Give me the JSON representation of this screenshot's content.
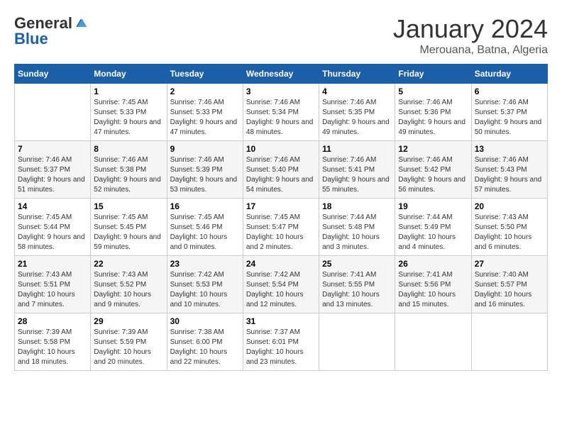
{
  "logo": {
    "general": "General",
    "blue": "Blue"
  },
  "title": {
    "month_year": "January 2024",
    "location": "Merouana, Batna, Algeria"
  },
  "weekdays": [
    "Sunday",
    "Monday",
    "Tuesday",
    "Wednesday",
    "Thursday",
    "Friday",
    "Saturday"
  ],
  "weeks": [
    [
      {
        "day": null,
        "sunrise": null,
        "sunset": null,
        "daylight": null
      },
      {
        "day": "1",
        "sunrise": "Sunrise: 7:45 AM",
        "sunset": "Sunset: 5:33 PM",
        "daylight": "Daylight: 9 hours and 47 minutes."
      },
      {
        "day": "2",
        "sunrise": "Sunrise: 7:46 AM",
        "sunset": "Sunset: 5:33 PM",
        "daylight": "Daylight: 9 hours and 47 minutes."
      },
      {
        "day": "3",
        "sunrise": "Sunrise: 7:46 AM",
        "sunset": "Sunset: 5:34 PM",
        "daylight": "Daylight: 9 hours and 48 minutes."
      },
      {
        "day": "4",
        "sunrise": "Sunrise: 7:46 AM",
        "sunset": "Sunset: 5:35 PM",
        "daylight": "Daylight: 9 hours and 49 minutes."
      },
      {
        "day": "5",
        "sunrise": "Sunrise: 7:46 AM",
        "sunset": "Sunset: 5:36 PM",
        "daylight": "Daylight: 9 hours and 49 minutes."
      },
      {
        "day": "6",
        "sunrise": "Sunrise: 7:46 AM",
        "sunset": "Sunset: 5:37 PM",
        "daylight": "Daylight: 9 hours and 50 minutes."
      }
    ],
    [
      {
        "day": "7",
        "sunrise": "Sunrise: 7:46 AM",
        "sunset": "Sunset: 5:37 PM",
        "daylight": "Daylight: 9 hours and 51 minutes."
      },
      {
        "day": "8",
        "sunrise": "Sunrise: 7:46 AM",
        "sunset": "Sunset: 5:38 PM",
        "daylight": "Daylight: 9 hours and 52 minutes."
      },
      {
        "day": "9",
        "sunrise": "Sunrise: 7:46 AM",
        "sunset": "Sunset: 5:39 PM",
        "daylight": "Daylight: 9 hours and 53 minutes."
      },
      {
        "day": "10",
        "sunrise": "Sunrise: 7:46 AM",
        "sunset": "Sunset: 5:40 PM",
        "daylight": "Daylight: 9 hours and 54 minutes."
      },
      {
        "day": "11",
        "sunrise": "Sunrise: 7:46 AM",
        "sunset": "Sunset: 5:41 PM",
        "daylight": "Daylight: 9 hours and 55 minutes."
      },
      {
        "day": "12",
        "sunrise": "Sunrise: 7:46 AM",
        "sunset": "Sunset: 5:42 PM",
        "daylight": "Daylight: 9 hours and 56 minutes."
      },
      {
        "day": "13",
        "sunrise": "Sunrise: 7:46 AM",
        "sunset": "Sunset: 5:43 PM",
        "daylight": "Daylight: 9 hours and 57 minutes."
      }
    ],
    [
      {
        "day": "14",
        "sunrise": "Sunrise: 7:45 AM",
        "sunset": "Sunset: 5:44 PM",
        "daylight": "Daylight: 9 hours and 58 minutes."
      },
      {
        "day": "15",
        "sunrise": "Sunrise: 7:45 AM",
        "sunset": "Sunset: 5:45 PM",
        "daylight": "Daylight: 9 hours and 59 minutes."
      },
      {
        "day": "16",
        "sunrise": "Sunrise: 7:45 AM",
        "sunset": "Sunset: 5:46 PM",
        "daylight": "Daylight: 10 hours and 0 minutes."
      },
      {
        "day": "17",
        "sunrise": "Sunrise: 7:45 AM",
        "sunset": "Sunset: 5:47 PM",
        "daylight": "Daylight: 10 hours and 2 minutes."
      },
      {
        "day": "18",
        "sunrise": "Sunrise: 7:44 AM",
        "sunset": "Sunset: 5:48 PM",
        "daylight": "Daylight: 10 hours and 3 minutes."
      },
      {
        "day": "19",
        "sunrise": "Sunrise: 7:44 AM",
        "sunset": "Sunset: 5:49 PM",
        "daylight": "Daylight: 10 hours and 4 minutes."
      },
      {
        "day": "20",
        "sunrise": "Sunrise: 7:43 AM",
        "sunset": "Sunset: 5:50 PM",
        "daylight": "Daylight: 10 hours and 6 minutes."
      }
    ],
    [
      {
        "day": "21",
        "sunrise": "Sunrise: 7:43 AM",
        "sunset": "Sunset: 5:51 PM",
        "daylight": "Daylight: 10 hours and 7 minutes."
      },
      {
        "day": "22",
        "sunrise": "Sunrise: 7:43 AM",
        "sunset": "Sunset: 5:52 PM",
        "daylight": "Daylight: 10 hours and 9 minutes."
      },
      {
        "day": "23",
        "sunrise": "Sunrise: 7:42 AM",
        "sunset": "Sunset: 5:53 PM",
        "daylight": "Daylight: 10 hours and 10 minutes."
      },
      {
        "day": "24",
        "sunrise": "Sunrise: 7:42 AM",
        "sunset": "Sunset: 5:54 PM",
        "daylight": "Daylight: 10 hours and 12 minutes."
      },
      {
        "day": "25",
        "sunrise": "Sunrise: 7:41 AM",
        "sunset": "Sunset: 5:55 PM",
        "daylight": "Daylight: 10 hours and 13 minutes."
      },
      {
        "day": "26",
        "sunrise": "Sunrise: 7:41 AM",
        "sunset": "Sunset: 5:56 PM",
        "daylight": "Daylight: 10 hours and 15 minutes."
      },
      {
        "day": "27",
        "sunrise": "Sunrise: 7:40 AM",
        "sunset": "Sunset: 5:57 PM",
        "daylight": "Daylight: 10 hours and 16 minutes."
      }
    ],
    [
      {
        "day": "28",
        "sunrise": "Sunrise: 7:39 AM",
        "sunset": "Sunset: 5:58 PM",
        "daylight": "Daylight: 10 hours and 18 minutes."
      },
      {
        "day": "29",
        "sunrise": "Sunrise: 7:39 AM",
        "sunset": "Sunset: 5:59 PM",
        "daylight": "Daylight: 10 hours and 20 minutes."
      },
      {
        "day": "30",
        "sunrise": "Sunrise: 7:38 AM",
        "sunset": "Sunset: 6:00 PM",
        "daylight": "Daylight: 10 hours and 22 minutes."
      },
      {
        "day": "31",
        "sunrise": "Sunrise: 7:37 AM",
        "sunset": "Sunset: 6:01 PM",
        "daylight": "Daylight: 10 hours and 23 minutes."
      },
      {
        "day": null,
        "sunrise": null,
        "sunset": null,
        "daylight": null
      },
      {
        "day": null,
        "sunrise": null,
        "sunset": null,
        "daylight": null
      },
      {
        "day": null,
        "sunrise": null,
        "sunset": null,
        "daylight": null
      }
    ]
  ]
}
